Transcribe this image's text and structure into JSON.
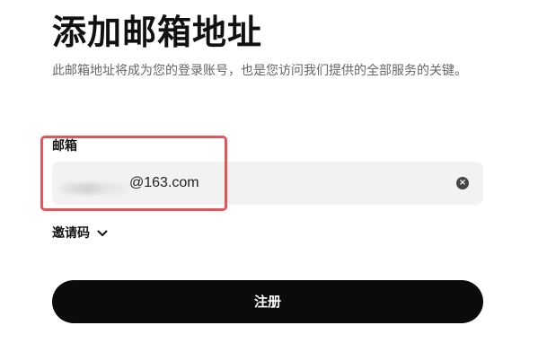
{
  "page": {
    "title": "添加邮箱地址",
    "subtitle": "此邮箱地址将成为您的登录账号，也是您访问我们提供的全部服务的关键。"
  },
  "email": {
    "label": "邮箱",
    "value": "@163.com",
    "clear_icon": "clear-circle-icon"
  },
  "invite": {
    "label": "邀请码",
    "icon": "chevron-down-icon"
  },
  "actions": {
    "register_label": "注册"
  },
  "colors": {
    "button_bg": "#0b0b0b",
    "field_bg": "#f2f2f2",
    "highlight": "#e4545a"
  }
}
